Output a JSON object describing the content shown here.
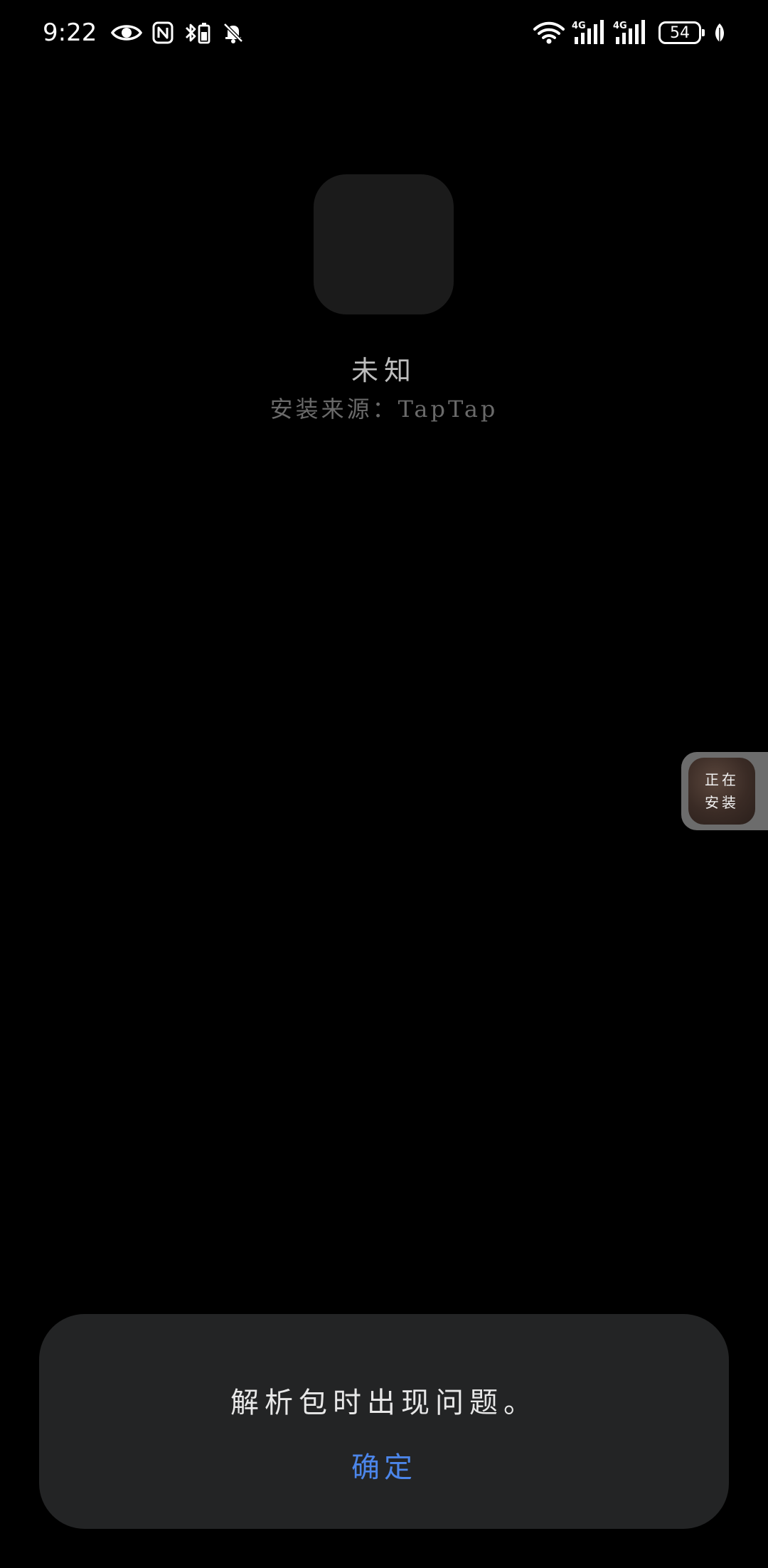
{
  "status_bar": {
    "time": "9:22",
    "battery_level": "54",
    "icons_left": [
      "eye-icon",
      "nfc-icon",
      "bluetooth-battery-icon",
      "mute-bell-icon"
    ],
    "icons_right": [
      "wifi-icon",
      "signal-4g-icon-1",
      "signal-4g-icon-2",
      "battery-icon",
      "power-saving-leaf-icon"
    ]
  },
  "app": {
    "name": "未知",
    "install_source": "安装来源：TapTap"
  },
  "float_widget": {
    "line1": "正在",
    "line2": "安装"
  },
  "dialog": {
    "message": "解析包时出现问题。",
    "confirm_label": "确定",
    "accent_color": "#4c86ea"
  }
}
